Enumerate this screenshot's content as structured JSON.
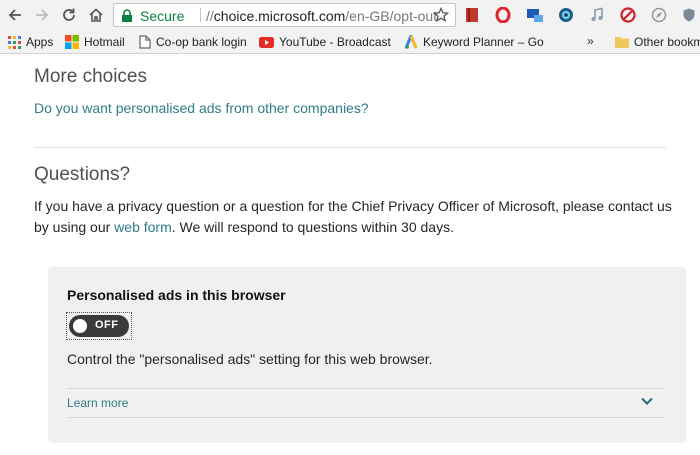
{
  "browser": {
    "secure_label": "Secure",
    "url_prefix": "//",
    "url_host": "choice.microsoft.com",
    "url_path": "/en-GB/opt-out"
  },
  "bookmarks": {
    "apps": "Apps",
    "hotmail": "Hotmail",
    "coop": "Co-op bank login",
    "youtube": "YouTube - Broadcast",
    "keyword": "Keyword Planner – Go",
    "more": "»",
    "other": "Other bookm"
  },
  "page": {
    "more_choices_heading": "More choices",
    "personalised_question": "Do you want personalised ads from other companies?",
    "questions_heading": "Questions?",
    "questions_text_1": "If you have a privacy question or a question for the Chief Privacy Officer of Microsoft, please contact us by using our ",
    "web_form_link": "web form",
    "questions_text_2": ". We will respond to questions within 30 days."
  },
  "card": {
    "title": "Personalised ads in this browser",
    "toggle_state": "OFF",
    "description": "Control the \"personalised ads\" setting for this web browser.",
    "learn_more": "Learn more"
  }
}
